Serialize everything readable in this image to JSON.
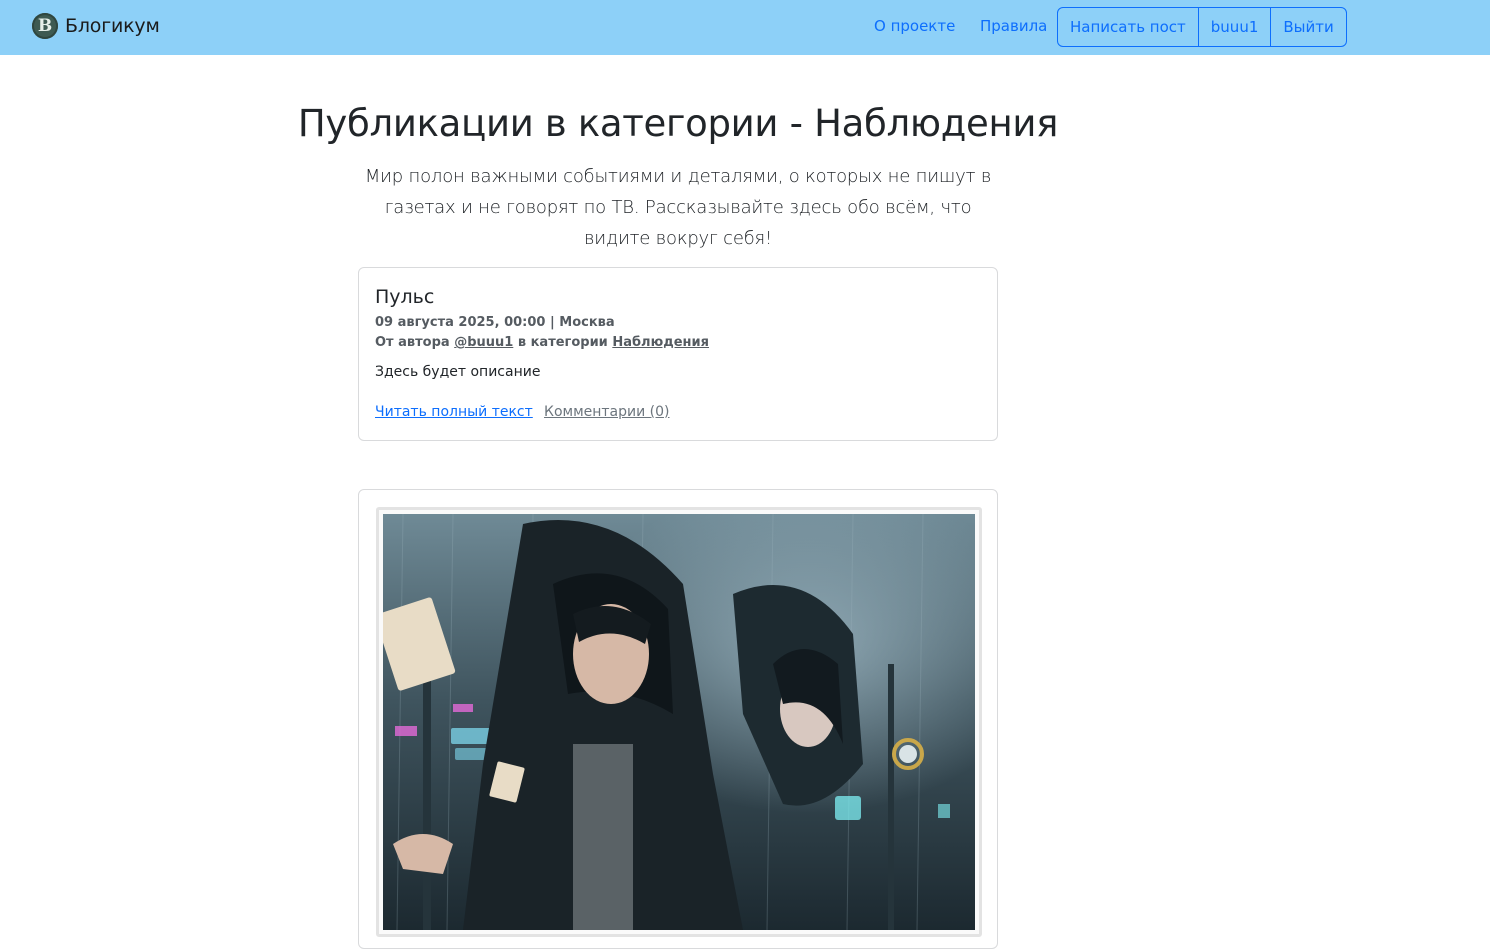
{
  "navbar": {
    "brand_letter": "B",
    "brand_name": "Блогикум",
    "links": {
      "about": "О проекте",
      "rules": "Правила"
    },
    "buttons": {
      "write_post": "Написать пост",
      "username": "buuu1",
      "logout": "Выйти"
    }
  },
  "header": {
    "title": "Публикации в категории - Наблюдения",
    "lead": "Мир полон важными событиями и деталями, о которых не пишут в газетах и не говорят по ТВ. Рассказывайте здесь обо всём, что видите вокруг себя!"
  },
  "posts": [
    {
      "title": "Пульс",
      "date": "09 августа 2025, 00:00",
      "separator": "|",
      "location": "Москва",
      "author_prefix": "От автора",
      "author": "@buuu1",
      "category_prefix": "в категории",
      "category": "Наблюдения",
      "description": "Здесь будет описание",
      "read_more": "Читать полный текст",
      "comments": "Комментарии (0)"
    }
  ],
  "image_post": {
    "image": "hooded-figures-rain-illustration"
  },
  "colors": {
    "navbar_bg": "#8dd0f8",
    "link_blue": "#0d6efd",
    "muted": "#6c757d"
  }
}
